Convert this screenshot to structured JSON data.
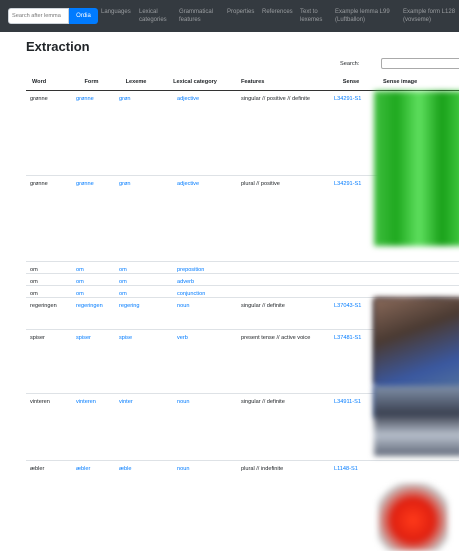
{
  "navbar": {
    "search_placeholder": "Search after lemma",
    "search_button": "Ordia",
    "links": [
      {
        "name": "nav-languages",
        "lines": [
          "Languages"
        ]
      },
      {
        "name": "nav-lexical-categories",
        "lines": [
          "Lexical",
          "categories"
        ]
      },
      {
        "name": "nav-grammatical-features",
        "lines": [
          "Grammatical",
          "features"
        ]
      },
      {
        "name": "nav-properties",
        "lines": [
          "Properties"
        ]
      },
      {
        "name": "nav-references",
        "lines": [
          "References"
        ]
      },
      {
        "name": "nav-text-to-lexemes",
        "lines": [
          "Text to",
          "lexemes"
        ]
      },
      {
        "name": "nav-example-lemma",
        "lines": [
          "Example lemma L99",
          "(Luftballon)"
        ]
      },
      {
        "name": "nav-example-form",
        "lines": [
          "Example form L128",
          "(vovseme)"
        ]
      }
    ]
  },
  "title": "Extraction",
  "search_label": "Search:",
  "table": {
    "headers": [
      "Word",
      "Form",
      "Lexeme",
      "Lexical category",
      "Features",
      "Sense",
      "Sense image"
    ],
    "rows": [
      {
        "word": "grønne",
        "form": "grønne",
        "lexeme": "grøn",
        "category": "adjective",
        "features": "singular // positive // definite",
        "sense": "L34291-S1",
        "image": "green"
      },
      {
        "word": "grønne",
        "form": "grønne",
        "lexeme": "grøn",
        "category": "adjective",
        "features": "plural // positive",
        "sense": "L34291-S1",
        "image": "green"
      },
      {
        "word": "om",
        "form": "om",
        "lexeme": "om",
        "category": "preposition",
        "features": "",
        "sense": "",
        "image": ""
      },
      {
        "word": "om",
        "form": "om",
        "lexeme": "om",
        "category": "adverb",
        "features": "",
        "sense": "",
        "image": ""
      },
      {
        "word": "om",
        "form": "om",
        "lexeme": "om",
        "category": "conjunction",
        "features": "",
        "sense": "",
        "image": ""
      },
      {
        "word": "regeringen",
        "form": "regeringen",
        "lexeme": "regering",
        "category": "noun",
        "features": "singular // definite",
        "sense": "L37043-S1",
        "image": "government"
      },
      {
        "word": "spiser",
        "form": "spiser",
        "lexeme": "spise",
        "category": "verb",
        "features": "present tense // active voice",
        "sense": "L37481-S1",
        "image": "eating"
      },
      {
        "word": "vinteren",
        "form": "vinteren",
        "lexeme": "vinter",
        "category": "noun",
        "features": "singular // definite",
        "sense": "L34911-S1",
        "image": "winter"
      },
      {
        "word": "æbler",
        "form": "æbler",
        "lexeme": "æble",
        "category": "noun",
        "features": "plural // indefinite",
        "sense": "L1148-S1",
        "image": "apple"
      }
    ]
  },
  "colors": {
    "navbar": "#343a40",
    "link": "#007bff",
    "button": "#007bff"
  }
}
